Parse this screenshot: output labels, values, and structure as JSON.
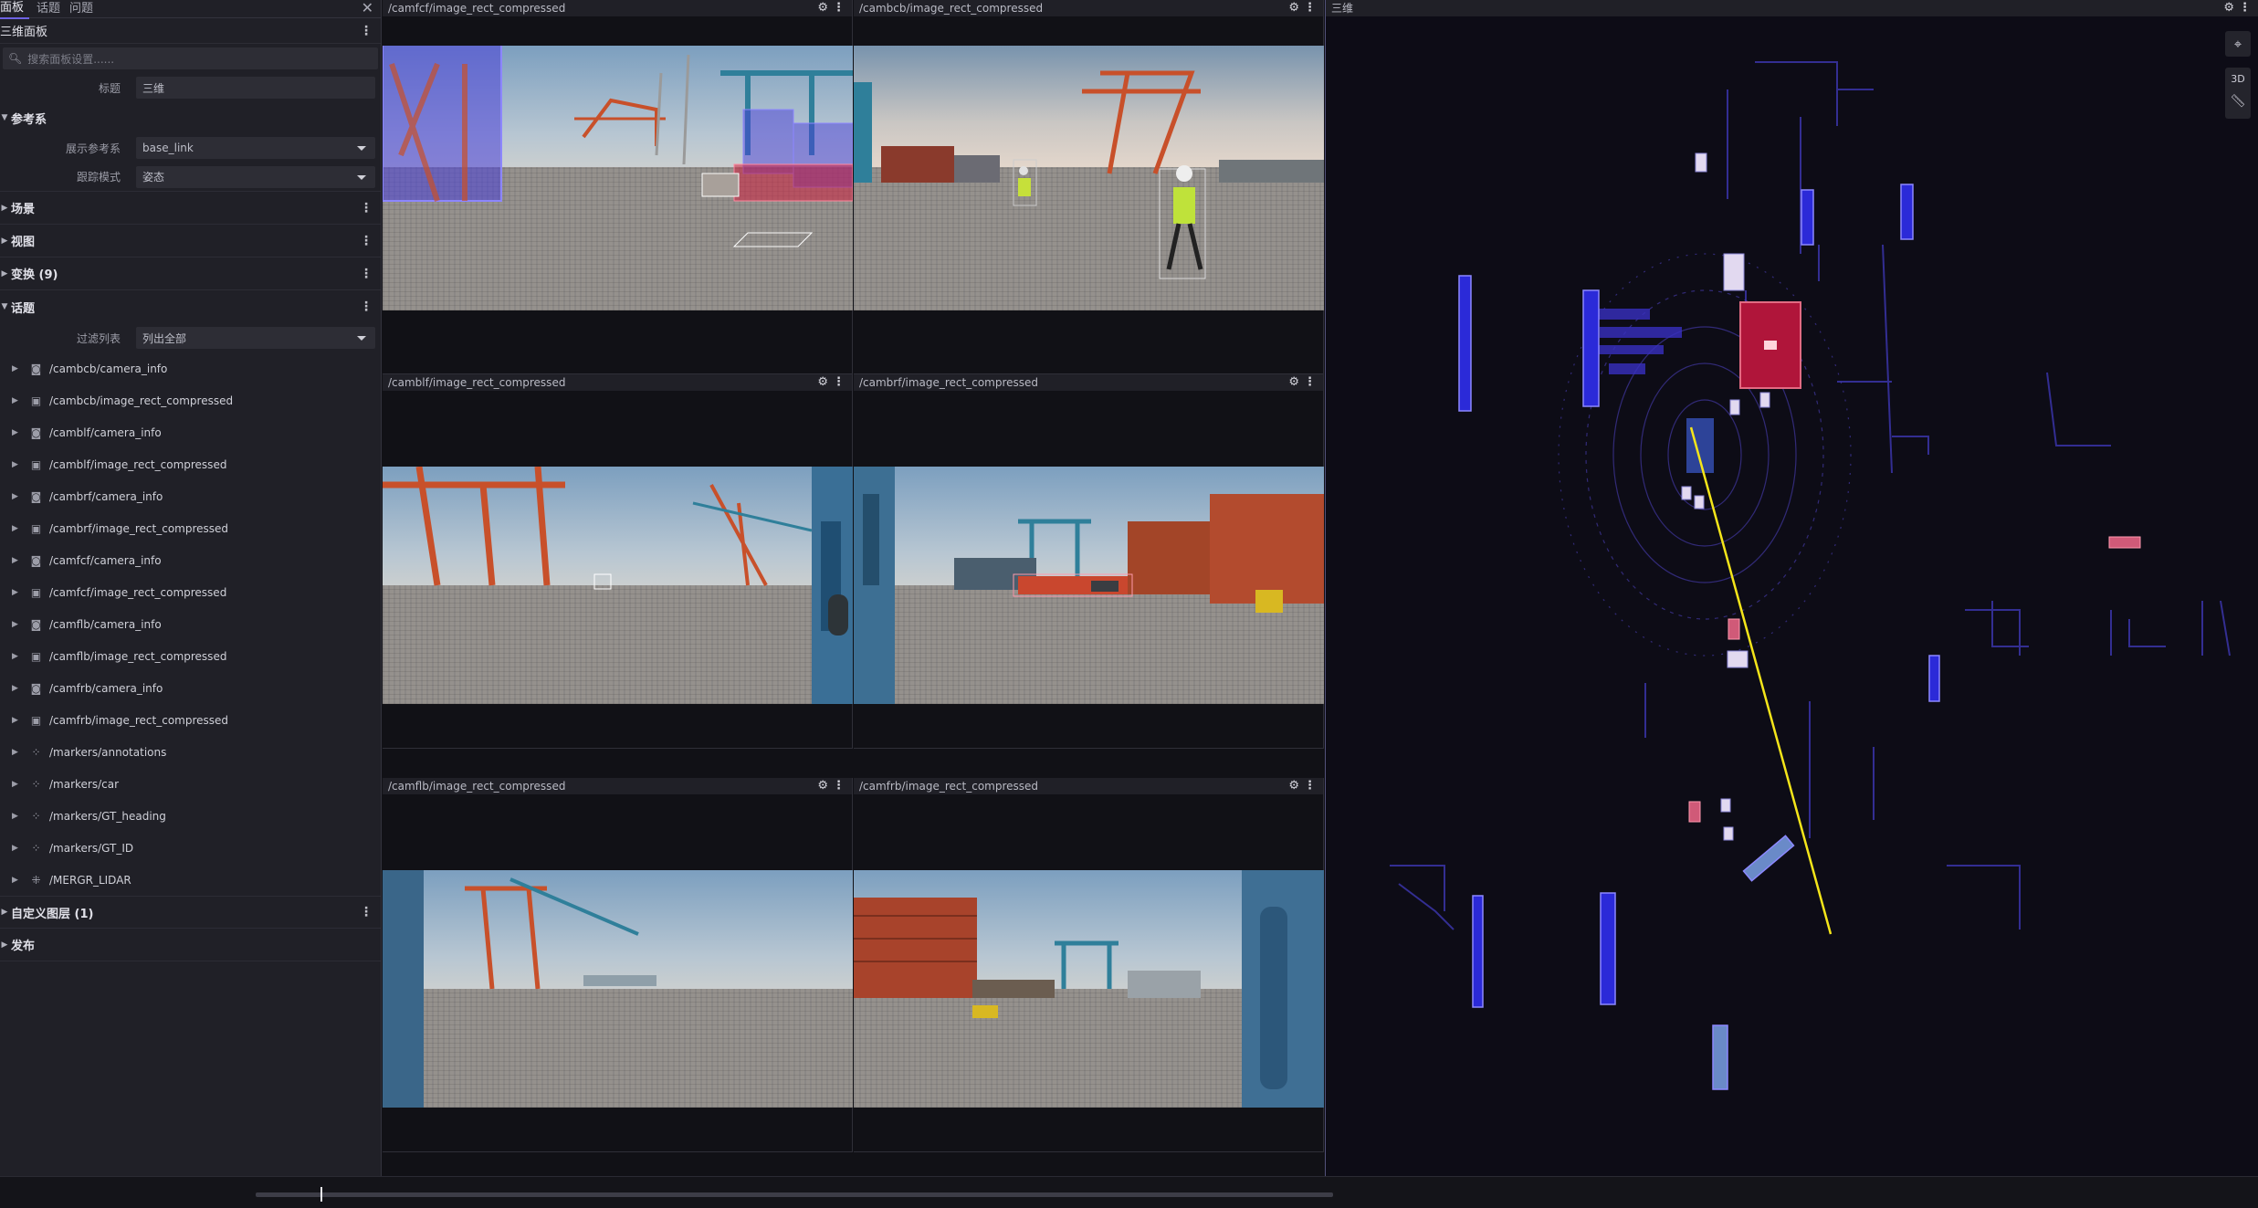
{
  "sidebar": {
    "tabs": [
      "面板",
      "话题",
      "问题"
    ],
    "panel_title": "三维面板",
    "search_placeholder": "搜索面板设置......",
    "title_label": "标题",
    "title_value": "三维",
    "frame_section": "参考系",
    "display_frame_label": "展示参考系",
    "display_frame_value": "base_link",
    "follow_mode_label": "跟踪模式",
    "follow_mode_value": "姿态",
    "sections": [
      "场景",
      "视图",
      "变换 (9)"
    ],
    "topics_section": "话题",
    "filter_label": "过滤列表",
    "filter_value": "列出全部",
    "topics": [
      {
        "name": "/cambcb/camera_info",
        "icon": "camera-icon"
      },
      {
        "name": "/cambcb/image_rect_compressed",
        "icon": "image-icon"
      },
      {
        "name": "/camblf/camera_info",
        "icon": "camera-icon"
      },
      {
        "name": "/camblf/image_rect_compressed",
        "icon": "image-icon"
      },
      {
        "name": "/cambrf/camera_info",
        "icon": "camera-icon"
      },
      {
        "name": "/cambrf/image_rect_compressed",
        "icon": "image-icon"
      },
      {
        "name": "/camfcf/camera_info",
        "icon": "camera-icon"
      },
      {
        "name": "/camfcf/image_rect_compressed",
        "icon": "image-icon"
      },
      {
        "name": "/camflb/camera_info",
        "icon": "camera-icon"
      },
      {
        "name": "/camflb/image_rect_compressed",
        "icon": "image-icon"
      },
      {
        "name": "/camfrb/camera_info",
        "icon": "camera-icon"
      },
      {
        "name": "/camfrb/image_rect_compressed",
        "icon": "image-icon"
      },
      {
        "name": "/markers/annotations",
        "icon": "markers-icon"
      },
      {
        "name": "/markers/car",
        "icon": "markers-icon"
      },
      {
        "name": "/markers/GT_heading",
        "icon": "markers-icon"
      },
      {
        "name": "/markers/GT_ID",
        "icon": "markers-icon"
      },
      {
        "name": "/MERGR_LIDAR",
        "icon": "pointcloud-icon"
      }
    ],
    "custom_layers": "自定义图层 (1)",
    "publish": "发布"
  },
  "images": [
    {
      "title": "/camfcf/image_rect_compressed"
    },
    {
      "title": "/cambcb/image_rect_compressed"
    },
    {
      "title": "/camblf/image_rect_compressed"
    },
    {
      "title": "/cambrf/image_rect_compressed"
    },
    {
      "title": "/camflb/image_rect_compressed"
    },
    {
      "title": "/camfrb/image_rect_compressed"
    }
  ],
  "view3d": {
    "title": "三维",
    "mode_label": "3D"
  }
}
